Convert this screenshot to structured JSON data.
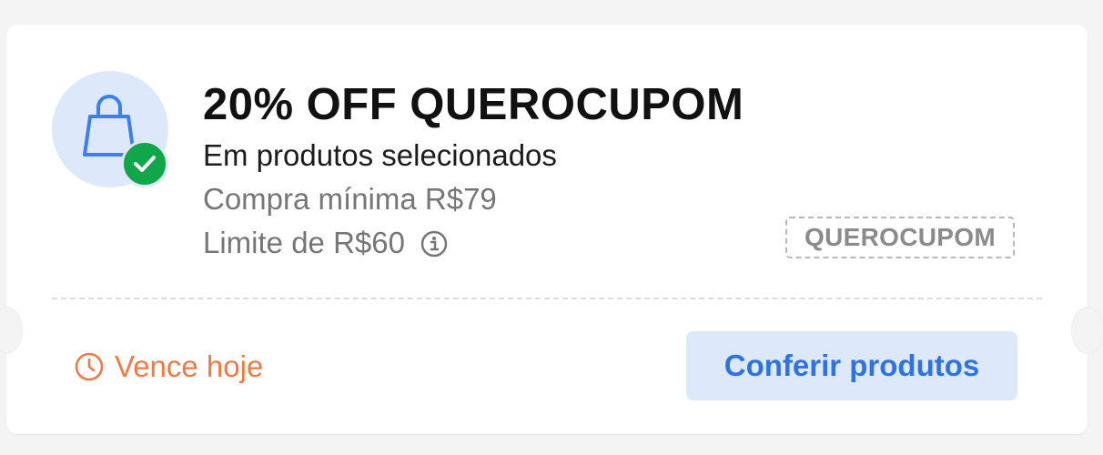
{
  "coupon": {
    "title": "20% OFF QUEROCUPOM",
    "subtitle": "Em produtos selecionados",
    "min_purchase": "Compra mínima R$79",
    "limit": "Limite de R$60",
    "code": "QUEROCUPOM",
    "expires": "Vence hoje",
    "cta_label": "Conferir produtos"
  },
  "icons": {
    "main": "shopping-bag-icon",
    "badge": "check-icon",
    "limit_info": "info-icon",
    "expires": "clock-icon"
  },
  "colors": {
    "accent_blue": "#2f72e6",
    "icon_bg": "#dde9fb",
    "success_green": "#12a64a",
    "warning_orange": "#ef7a45"
  }
}
